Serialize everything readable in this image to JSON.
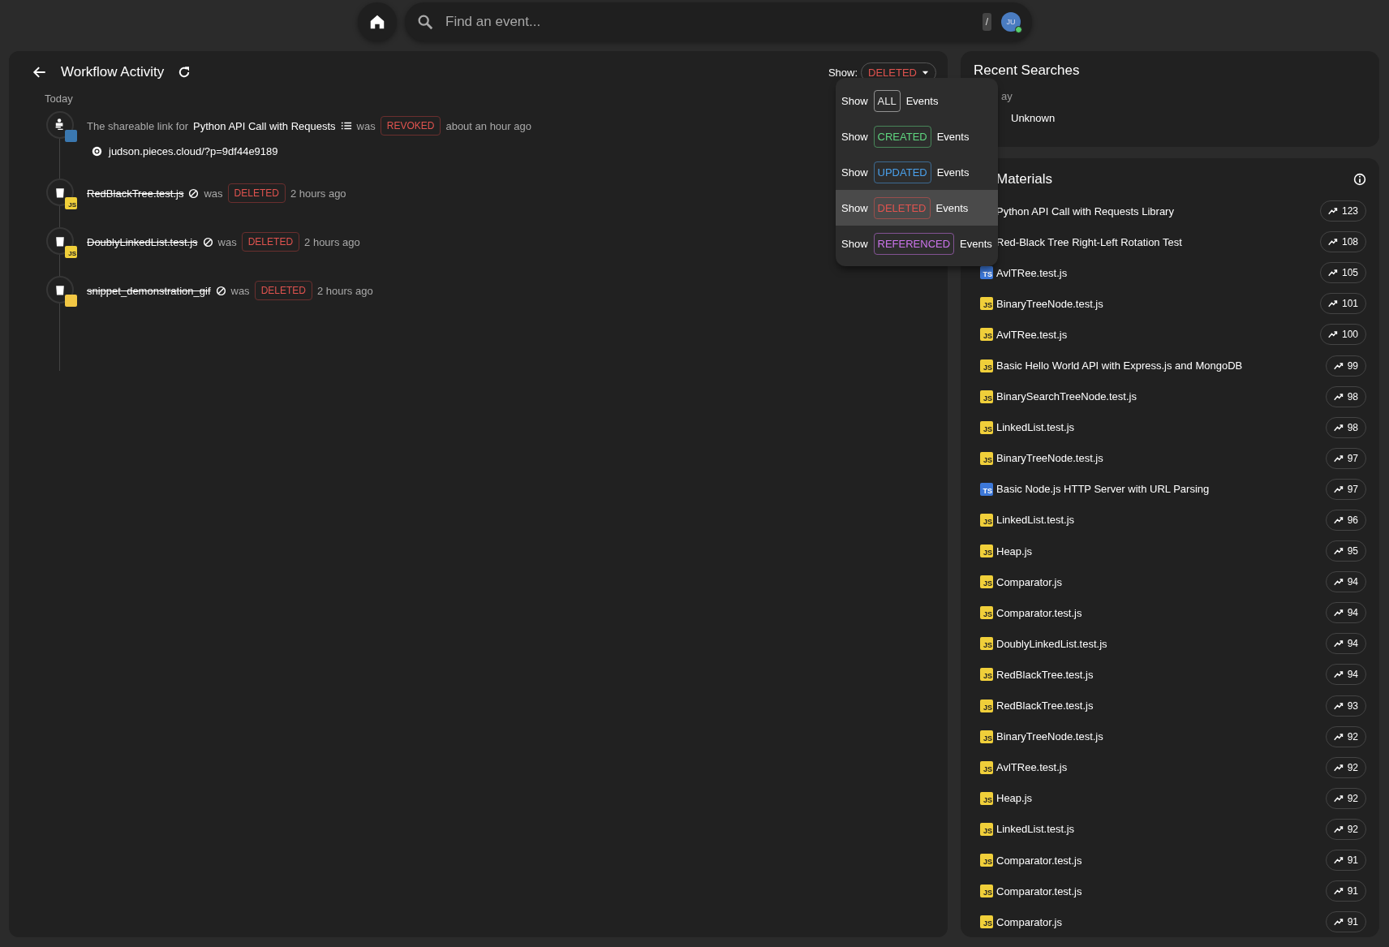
{
  "top_bar": {
    "search": {
      "placeholder": "Find an event..."
    },
    "shortcut": "/",
    "avatar": {
      "initials": "JU",
      "online": true
    }
  },
  "activity": {
    "title": "Workflow Activity",
    "filter_label": "Show:",
    "filter_value": "DELETED",
    "group": "Today",
    "events": [
      {
        "kind": "share",
        "badge": {
          "kind": "python"
        },
        "prefix": "The shareable link for",
        "name": "Python API Call with Requests",
        "verb": "was",
        "tag": "REVOKED",
        "time": "about an hour ago",
        "link": "judson.pieces.cloud/?p=9df44e9189"
      },
      {
        "kind": "delete",
        "badge": {
          "kind": "js",
          "label": "JS"
        },
        "name": "RedBlackTree.test.js",
        "verb": "was",
        "tag": "DELETED",
        "time": "2 hours ago"
      },
      {
        "kind": "delete",
        "badge": {
          "kind": "js",
          "label": "JS"
        },
        "name": "DoublyLinkedList.test.js",
        "verb": "was",
        "tag": "DELETED",
        "time": "2 hours ago"
      },
      {
        "kind": "delete",
        "badge": {
          "kind": "gif"
        },
        "name": "snippet_demonstration_gif",
        "verb": "was",
        "tag": "DELETED",
        "time": "2 hours ago"
      }
    ]
  },
  "filter_menu": [
    {
      "show": "Show",
      "tag": "ALL",
      "events": "Events",
      "color": "#e8e8e8",
      "selected": false
    },
    {
      "show": "Show",
      "tag": "CREATED",
      "events": "Events",
      "color": "#5fd47f",
      "selected": false
    },
    {
      "show": "Show",
      "tag": "UPDATED",
      "events": "Events",
      "color": "#4aa0ea",
      "selected": false
    },
    {
      "show": "Show",
      "tag": "DELETED",
      "events": "Events",
      "color": "#e0534f",
      "selected": true
    },
    {
      "show": "Show",
      "tag": "REFERENCED",
      "events": "Events",
      "color": "#cc74ec",
      "selected": false
    }
  ],
  "recent_searches": {
    "title": "Recent Searches",
    "group": "ay",
    "items": [
      "Unknown"
    ]
  },
  "materials": {
    "title": "Materials",
    "items": [
      {
        "name": "Python API Call with Requests Library",
        "count": "123"
      },
      {
        "name": "Red-Black Tree Right-Left Rotation Test",
        "count": "108"
      },
      {
        "name": "AvlTRee.test.js",
        "type": "TS",
        "count": "105"
      },
      {
        "name": "BinaryTreeNode.test.js",
        "type": "JS",
        "count": "101"
      },
      {
        "name": "AvlTRee.test.js",
        "type": "JS",
        "count": "100"
      },
      {
        "name": "Basic Hello World API with Express.js and MongoDB",
        "type": "JS",
        "count": "99"
      },
      {
        "name": "BinarySearchTreeNode.test.js",
        "type": "JS",
        "count": "98"
      },
      {
        "name": "LinkedList.test.js",
        "type": "JS",
        "count": "98"
      },
      {
        "name": "BinaryTreeNode.test.js",
        "type": "JS",
        "count": "97"
      },
      {
        "name": "Basic Node.js HTTP Server with URL Parsing",
        "type": "TS",
        "count": "97"
      },
      {
        "name": "LinkedList.test.js",
        "type": "JS",
        "count": "96"
      },
      {
        "name": "Heap.js",
        "type": "JS",
        "count": "95"
      },
      {
        "name": "Comparator.js",
        "type": "JS",
        "count": "94"
      },
      {
        "name": "Comparator.test.js",
        "type": "JS",
        "count": "94"
      },
      {
        "name": "DoublyLinkedList.test.js",
        "type": "JS",
        "count": "94"
      },
      {
        "name": "RedBlackTree.test.js",
        "type": "JS",
        "count": "94"
      },
      {
        "name": "RedBlackTree.test.js",
        "type": "JS",
        "count": "93"
      },
      {
        "name": "BinaryTreeNode.test.js",
        "type": "JS",
        "count": "92"
      },
      {
        "name": "AvlTRee.test.js",
        "type": "JS",
        "count": "92"
      },
      {
        "name": "Heap.js",
        "type": "JS",
        "count": "92"
      },
      {
        "name": "LinkedList.test.js",
        "type": "JS",
        "count": "92"
      },
      {
        "name": "Comparator.test.js",
        "type": "JS",
        "count": "91"
      },
      {
        "name": "Comparator.test.js",
        "type": "JS",
        "count": "91"
      },
      {
        "name": "Comparator.js",
        "type": "JS",
        "count": "91"
      }
    ]
  }
}
